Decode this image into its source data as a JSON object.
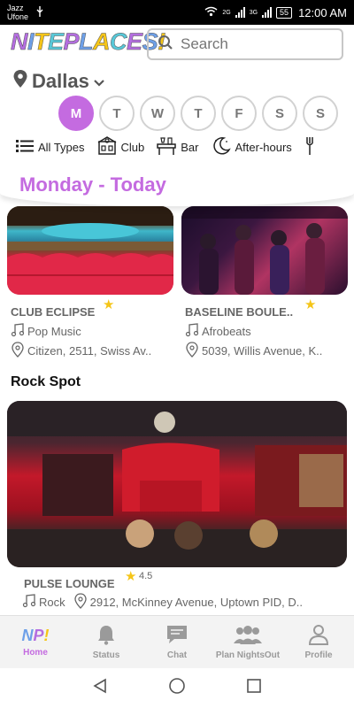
{
  "status_bar": {
    "carrier_1": "Jazz",
    "carrier_2": "Ufone",
    "net_1": "2G",
    "net_2": "3G",
    "battery": "55",
    "time": "12:00 AM"
  },
  "header": {
    "logo_letters": [
      "N",
      "I",
      "T",
      "E",
      "P",
      "L",
      "A",
      "C",
      "E",
      "S",
      "!"
    ],
    "logo_colors": [
      "#b46ee0",
      "#6ea0e8",
      "#f5c518",
      "#58c8d8",
      "#b46ee0",
      "#6ea0e8",
      "#f5c518",
      "#58c8d8",
      "#b46ee0",
      "#6ea0e8",
      "#f5c518"
    ],
    "search_placeholder": "Search",
    "city": "Dallas",
    "days": [
      "M",
      "T",
      "W",
      "T",
      "F",
      "S",
      "S"
    ],
    "active_day_index": 0,
    "types": [
      {
        "label": "All Types",
        "icon": "list-icon"
      },
      {
        "label": "Club",
        "icon": "club-icon"
      },
      {
        "label": "Bar",
        "icon": "bar-icon"
      },
      {
        "label": "After-hours",
        "icon": "moon-icon"
      }
    ],
    "today_label": "Monday - Today"
  },
  "venues_top": [
    {
      "name": "CLUB ECLIPSE",
      "genre": "Pop Music",
      "address": "Citizen, 2511, Swiss Av.."
    },
    {
      "name": "BASELINE BOULE..",
      "genre": "Afrobeats",
      "address": "5039, Willis Avenue, K.."
    }
  ],
  "section": {
    "title": "Rock Spot",
    "venue": {
      "name": "PULSE LOUNGE",
      "rating": "4.5",
      "genre": "Rock",
      "address": "2912, McKinney Avenue, Uptown PID, D.."
    }
  },
  "bottom_nav": [
    {
      "label": "Home",
      "icon": "np-logo-icon"
    },
    {
      "label": "Status",
      "icon": "bell-icon"
    },
    {
      "label": "Chat",
      "icon": "chat-icon"
    },
    {
      "label": "Plan NightsOut",
      "icon": "group-icon"
    },
    {
      "label": "Profile",
      "icon": "person-icon"
    }
  ],
  "colors": {
    "accent": "#c46be0",
    "star": "#f5c518"
  }
}
